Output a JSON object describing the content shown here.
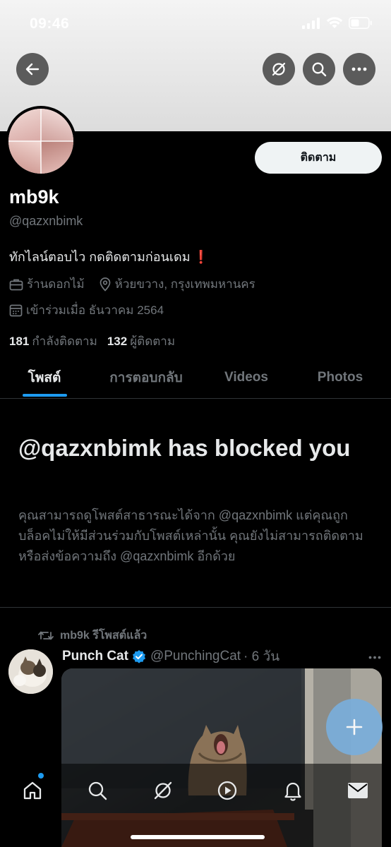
{
  "status_bar": {
    "time": "09:46"
  },
  "profile": {
    "display_name": "mb9k",
    "handle": "@qazxnbimk",
    "bio": "ทักไลน์ตอบไว กดติดตามก่อนเดม",
    "bio_emoji": "❗",
    "category": "ร้านดอกไม้",
    "location": "ห้วยขวาง, กรุงเทพมหานคร",
    "joined": "เข้าร่วมเมื่อ ธันวาคม 2564",
    "following_count": "181",
    "following_label": "กำลังติดตาม",
    "followers_count": "132",
    "followers_label": "ผู้ติดตาม",
    "follow_button_label": "ติดตาม"
  },
  "tabs": [
    {
      "label": "โพสต์",
      "active": true
    },
    {
      "label": "การตอบกลับ",
      "active": false
    },
    {
      "label": "Videos",
      "active": false
    },
    {
      "label": "Photos",
      "active": false
    }
  ],
  "blocked": {
    "title": "@qazxnbimk has blocked you",
    "body": "คุณสามารถดูโพสต์สาธารณะได้จาก @qazxnbimk แต่คุณถูกบล็อคไม่ให้มีส่วนร่วมกับโพสต์เหล่านั้น คุณยังไม่สามารถติดตามหรือส่งข้อความถึง @qazxnbimk อีกด้วย"
  },
  "tweet": {
    "repost_label": "mb9k รีโพสต์แล้ว",
    "author_name": "Punch Cat",
    "author_handle": "@PunchingCat",
    "time": "· 6 วัน",
    "verified": true
  },
  "colors": {
    "accent": "#1d9bf0",
    "background": "#000000",
    "secondary_text": "#71767b",
    "fab": "#7aaedb"
  },
  "icons": {
    "back": "arrow-left-icon",
    "grok": "grok-icon",
    "search": "search-icon",
    "more": "more-icon",
    "home": "home-icon",
    "notifications": "bell-icon",
    "messages": "mail-icon",
    "spaces": "play-circle-icon",
    "compose": "plus-icon"
  }
}
